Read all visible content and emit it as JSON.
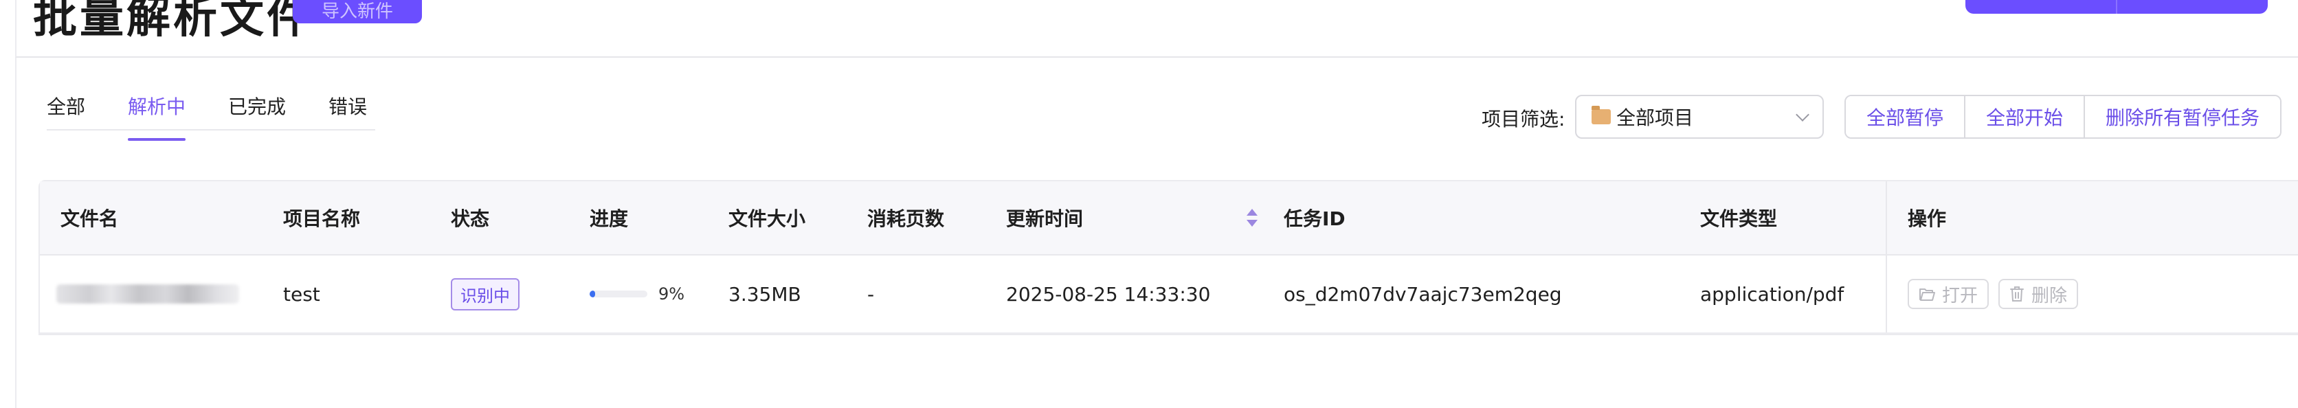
{
  "header": {
    "title": "批量解析文件",
    "title_button_label": "导入新件"
  },
  "tabs": [
    {
      "label": "全部",
      "active": false
    },
    {
      "label": "解析中",
      "active": true
    },
    {
      "label": "已完成",
      "active": false
    },
    {
      "label": "错误",
      "active": false
    }
  ],
  "filter": {
    "label": "项目筛选:",
    "selected": "全部项目",
    "icon": "folder-icon"
  },
  "actions": {
    "pause_all": "全部暂停",
    "start_all": "全部开始",
    "delete_paused": "删除所有暂停任务"
  },
  "table": {
    "columns": [
      "文件名",
      "项目名称",
      "状态",
      "进度",
      "文件大小",
      "消耗页数",
      "更新时间",
      "任务ID",
      "文件类型",
      "操作"
    ],
    "rows": [
      {
        "file_name": "",
        "project": "test",
        "status": "识别中",
        "progress": 0.09,
        "progress_text": "9%",
        "size": "3.35MB",
        "pages": "-",
        "updated": "2025-08-25 14:33:30",
        "task_id": "os_d2m07dv7aajc73em2qeg",
        "file_type": "application/pdf",
        "open_label": "打开",
        "delete_label": "删除"
      }
    ]
  },
  "colors": {
    "accent": "#6b4eff",
    "progress": "#3b6ef0"
  }
}
